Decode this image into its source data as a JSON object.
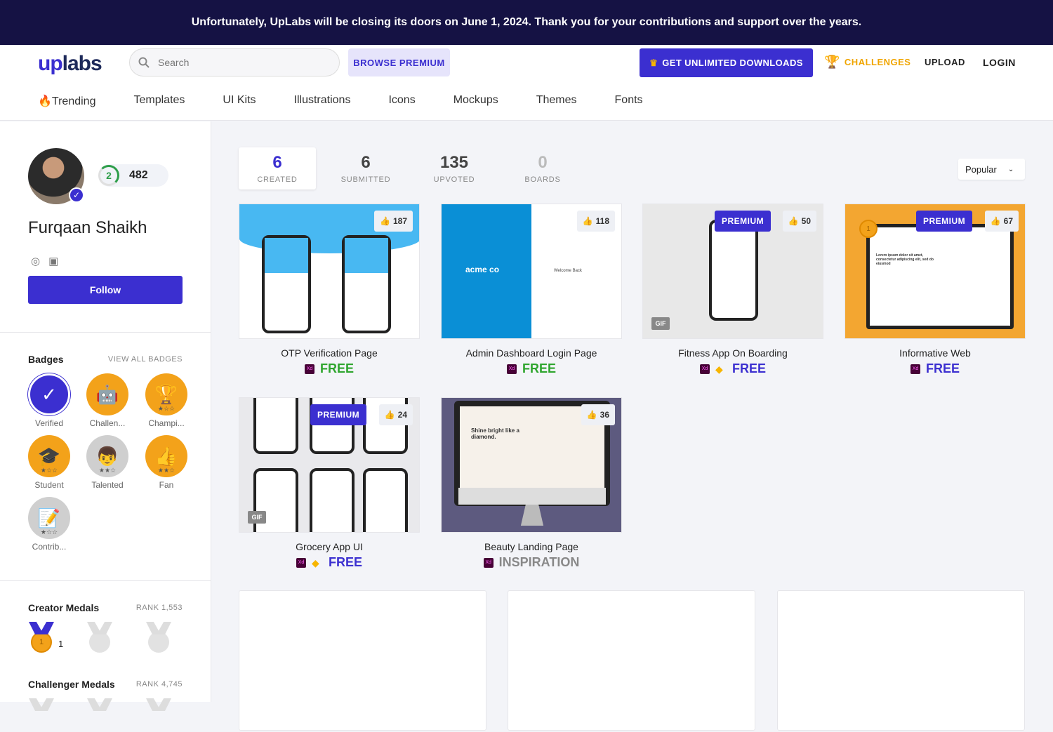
{
  "banner": {
    "text": "Unfortunately, UpLabs will be closing its doors on June 1, 2024. Thank you for your contributions and support over the years."
  },
  "header": {
    "logo_up": "up",
    "logo_labs": "labs",
    "search_placeholder": "Search",
    "browse_premium": "BROWSE PREMIUM",
    "get_unlimited": "GET UNLIMITED DOWNLOADS",
    "challenges": "CHALLENGES",
    "upload": "UPLOAD",
    "login": "LOGIN"
  },
  "nav": [
    "🔥Trending",
    "Templates",
    "UI Kits",
    "Illustrations",
    "Icons",
    "Mockups",
    "Themes",
    "Fonts"
  ],
  "profile": {
    "name": "Furqaan Shaikh",
    "level": "2",
    "points": "482",
    "follow": "Follow"
  },
  "badges": {
    "title": "Badges",
    "view_all": "VIEW ALL BADGES",
    "items": [
      {
        "label": "Verified",
        "icon": "checkmark-icon",
        "color": "#3b2fd0"
      },
      {
        "label": "Challen...",
        "icon": "robot-icon",
        "color": "#f3a21a"
      },
      {
        "label": "Champi...",
        "icon": "trophy-icon",
        "color": "#f3a21a"
      },
      {
        "label": "Student",
        "icon": "graduation-cap-icon",
        "color": "#f3a21a"
      },
      {
        "label": "Talented",
        "icon": "person-icon",
        "color": "#cfcfcf"
      },
      {
        "label": "Fan",
        "icon": "thumbs-up-icon",
        "color": "#f3a21a"
      },
      {
        "label": "Contrib...",
        "icon": "notepad-icon",
        "color": "#cfcfcf"
      }
    ]
  },
  "creator_medals": {
    "title": "Creator Medals",
    "rank": "RANK 1,553",
    "gold_count": "1"
  },
  "challenger_medals": {
    "title": "Challenger Medals",
    "rank": "RANK 4,745"
  },
  "stats": [
    {
      "value": "6",
      "label": "CREATED"
    },
    {
      "value": "6",
      "label": "SUBMITTED"
    },
    {
      "value": "135",
      "label": "UPVOTED"
    },
    {
      "value": "0",
      "label": "BOARDS"
    }
  ],
  "sort": {
    "value": "Popular"
  },
  "cards": [
    {
      "title": "OTP Verification Page",
      "likes": "187",
      "price": "FREE",
      "price_color": "#2ea52e",
      "premium": "",
      "gif": ""
    },
    {
      "title": "Admin Dashboard Login Page",
      "likes": "118",
      "price": "FREE",
      "price_color": "#2ea52e",
      "premium": "",
      "gif": ""
    },
    {
      "title": "Fitness App On Boarding",
      "likes": "50",
      "price": "FREE",
      "price_color": "#3b2fd0",
      "premium": "PREMIUM",
      "gif": "GIF"
    },
    {
      "title": "Informative Web",
      "likes": "67",
      "price": "FREE",
      "price_color": "#3b2fd0",
      "premium": "PREMIUM",
      "gif": ""
    },
    {
      "title": "Grocery App UI",
      "likes": "24",
      "price": "FREE",
      "price_color": "#3b2fd0",
      "premium": "PREMIUM",
      "gif": "GIF"
    },
    {
      "title": "Beauty Landing Page",
      "likes": "36",
      "price": "INSPIRATION",
      "price_color": "#888888",
      "premium": "",
      "gif": ""
    }
  ],
  "thumb_text": {
    "acme": "acme co",
    "welcome": "Welcome Back",
    "shine": "Shine bright like a diamond.",
    "lorem": "Lorem ipsum dolor sit amet, consectetur adipiscing elit, sed do eiusmod"
  }
}
